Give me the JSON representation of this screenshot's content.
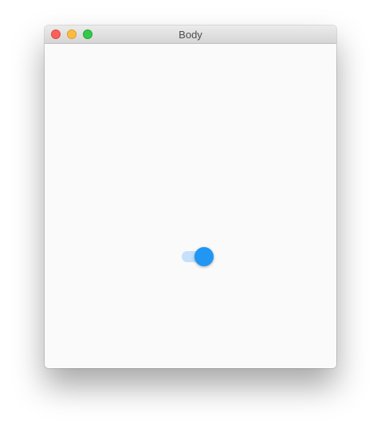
{
  "window": {
    "title": "Body"
  },
  "switch": {
    "checked": true,
    "thumb_color": "#2196f3",
    "track_color": "#c5e0fa"
  },
  "traffic_lights": {
    "close_color": "#fc605b",
    "minimize_color": "#fdbc40",
    "maximize_color": "#34c84a"
  }
}
